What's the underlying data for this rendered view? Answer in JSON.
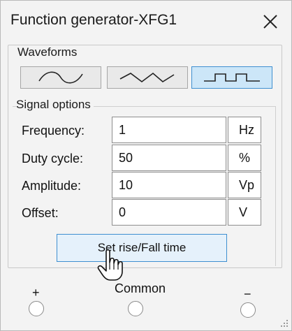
{
  "window": {
    "title": "Function generator-XFG1",
    "close_icon": "close-icon"
  },
  "waveforms": {
    "label": "Waveforms",
    "buttons": [
      {
        "name": "sine",
        "icon": "sine-wave-icon",
        "selected": false
      },
      {
        "name": "triangle",
        "icon": "triangle-wave-icon",
        "selected": false
      },
      {
        "name": "square",
        "icon": "square-wave-icon",
        "selected": true
      }
    ]
  },
  "signal_options": {
    "label": "Signal options",
    "rows": [
      {
        "label": "Frequency:",
        "value": "1",
        "unit": "Hz"
      },
      {
        "label": "Duty cycle:",
        "value": "50",
        "unit": "%"
      },
      {
        "label": "Amplitude:",
        "value": "10",
        "unit": "Vp"
      },
      {
        "label": "Offset:",
        "value": "0",
        "unit": "V"
      }
    ],
    "rise_fall_button": "Set rise/Fall time"
  },
  "terminals": {
    "plus": "+",
    "common": "Common",
    "minus": "−"
  },
  "colors": {
    "selected_accent": "#3e8fd0",
    "selected_fill": "#cce6f8"
  }
}
